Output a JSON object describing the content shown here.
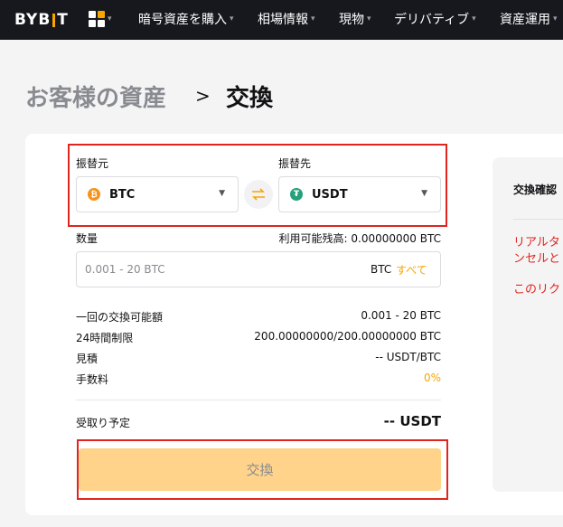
{
  "nav": {
    "logo_left": "BYB",
    "logo_right": "T",
    "items": [
      {
        "label": "暗号資産を購入"
      },
      {
        "label": "相場情報"
      },
      {
        "label": "現物"
      },
      {
        "label": "デリバティブ"
      },
      {
        "label": "資産運用"
      }
    ],
    "caret": "▾"
  },
  "breadcrumb": {
    "parent": "お客様の資産",
    "separator": ">",
    "current": "交換"
  },
  "exchange": {
    "from_label": "振替元",
    "from_coin": "BTC",
    "to_label": "振替先",
    "to_coin": "USDT",
    "amount_label": "数量",
    "available": "利用可能残高: 0.00000000 BTC",
    "amount_placeholder": "0.001 - 20 BTC",
    "amount_unit": "BTC",
    "all_button": "すべて",
    "details": [
      {
        "key": "一回の交換可能額",
        "value": "0.001 - 20 BTC"
      },
      {
        "key": "24時間制限",
        "value": "200.00000000/200.00000000 BTC"
      },
      {
        "key": "見積",
        "value": "-- USDT/BTC"
      },
      {
        "key": "手数料",
        "value": "0%"
      }
    ],
    "receive_label": "受取り予定",
    "receive_value": "-- USDT",
    "submit_label": "交換"
  },
  "confirm_panel": {
    "title": "交換確認",
    "line1": "リアルタ",
    "line2": "ンセルと",
    "line3": "このリク"
  },
  "colors": {
    "accent": "#f7a600",
    "btc": "#f7931a",
    "usdt": "#26a17b",
    "highlight": "#e0251f",
    "button_disabled": "#ffd38a"
  }
}
